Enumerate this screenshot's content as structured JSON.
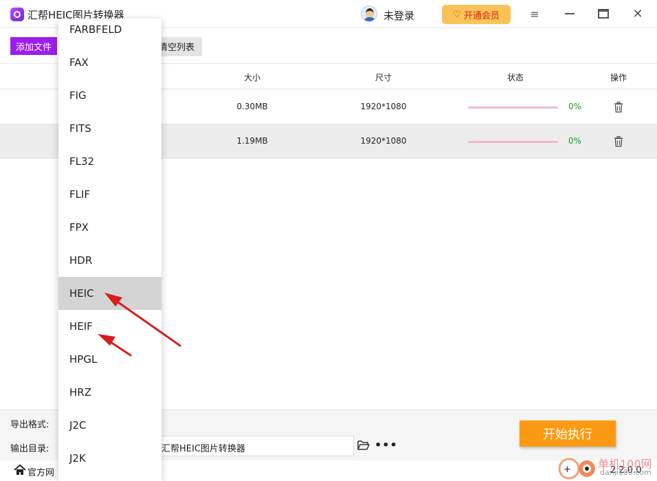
{
  "titlebar": {
    "app_title": "汇帮HEIC图片转换器",
    "login_text": "未登录",
    "vip_label": "开通会员"
  },
  "toolbar": {
    "add_label": "添加文件",
    "clear_label": "清空列表"
  },
  "table": {
    "headers": {
      "size": "大小",
      "dimension": "尺寸",
      "status": "状态",
      "action": "操作"
    },
    "rows": [
      {
        "size": "0.30MB",
        "dimension": "1920*1080",
        "progress": 0,
        "percent": "0%"
      },
      {
        "size": "1.19MB",
        "dimension": "1920*1080",
        "progress": 0,
        "percent": "0%"
      }
    ]
  },
  "dropdown": {
    "items": [
      "FARBFELD",
      "FAX",
      "FIG",
      "FITS",
      "FL32",
      "FLIF",
      "FPX",
      "HDR",
      "HEIC",
      "HEIF",
      "HPGL",
      "HRZ",
      "J2C",
      "J2K"
    ],
    "selected": "HEIC"
  },
  "bottom": {
    "format_label": "导出格式:",
    "dir_label": "输出目录:",
    "dir_value": "汇帮HEIC图片转换器",
    "start_label": "开始执行",
    "footer_link": "官方网",
    "version": "2.2.0.0"
  },
  "watermark": {
    "cn": "单机100网",
    "en": "danji100.com"
  },
  "colors": {
    "accent": "#9b1eee",
    "start": "#fb9a12",
    "vip": "#fbc356",
    "progress": "#f2b8c8",
    "percent": "#1a9c1a",
    "arrow": "#d91c1c"
  }
}
